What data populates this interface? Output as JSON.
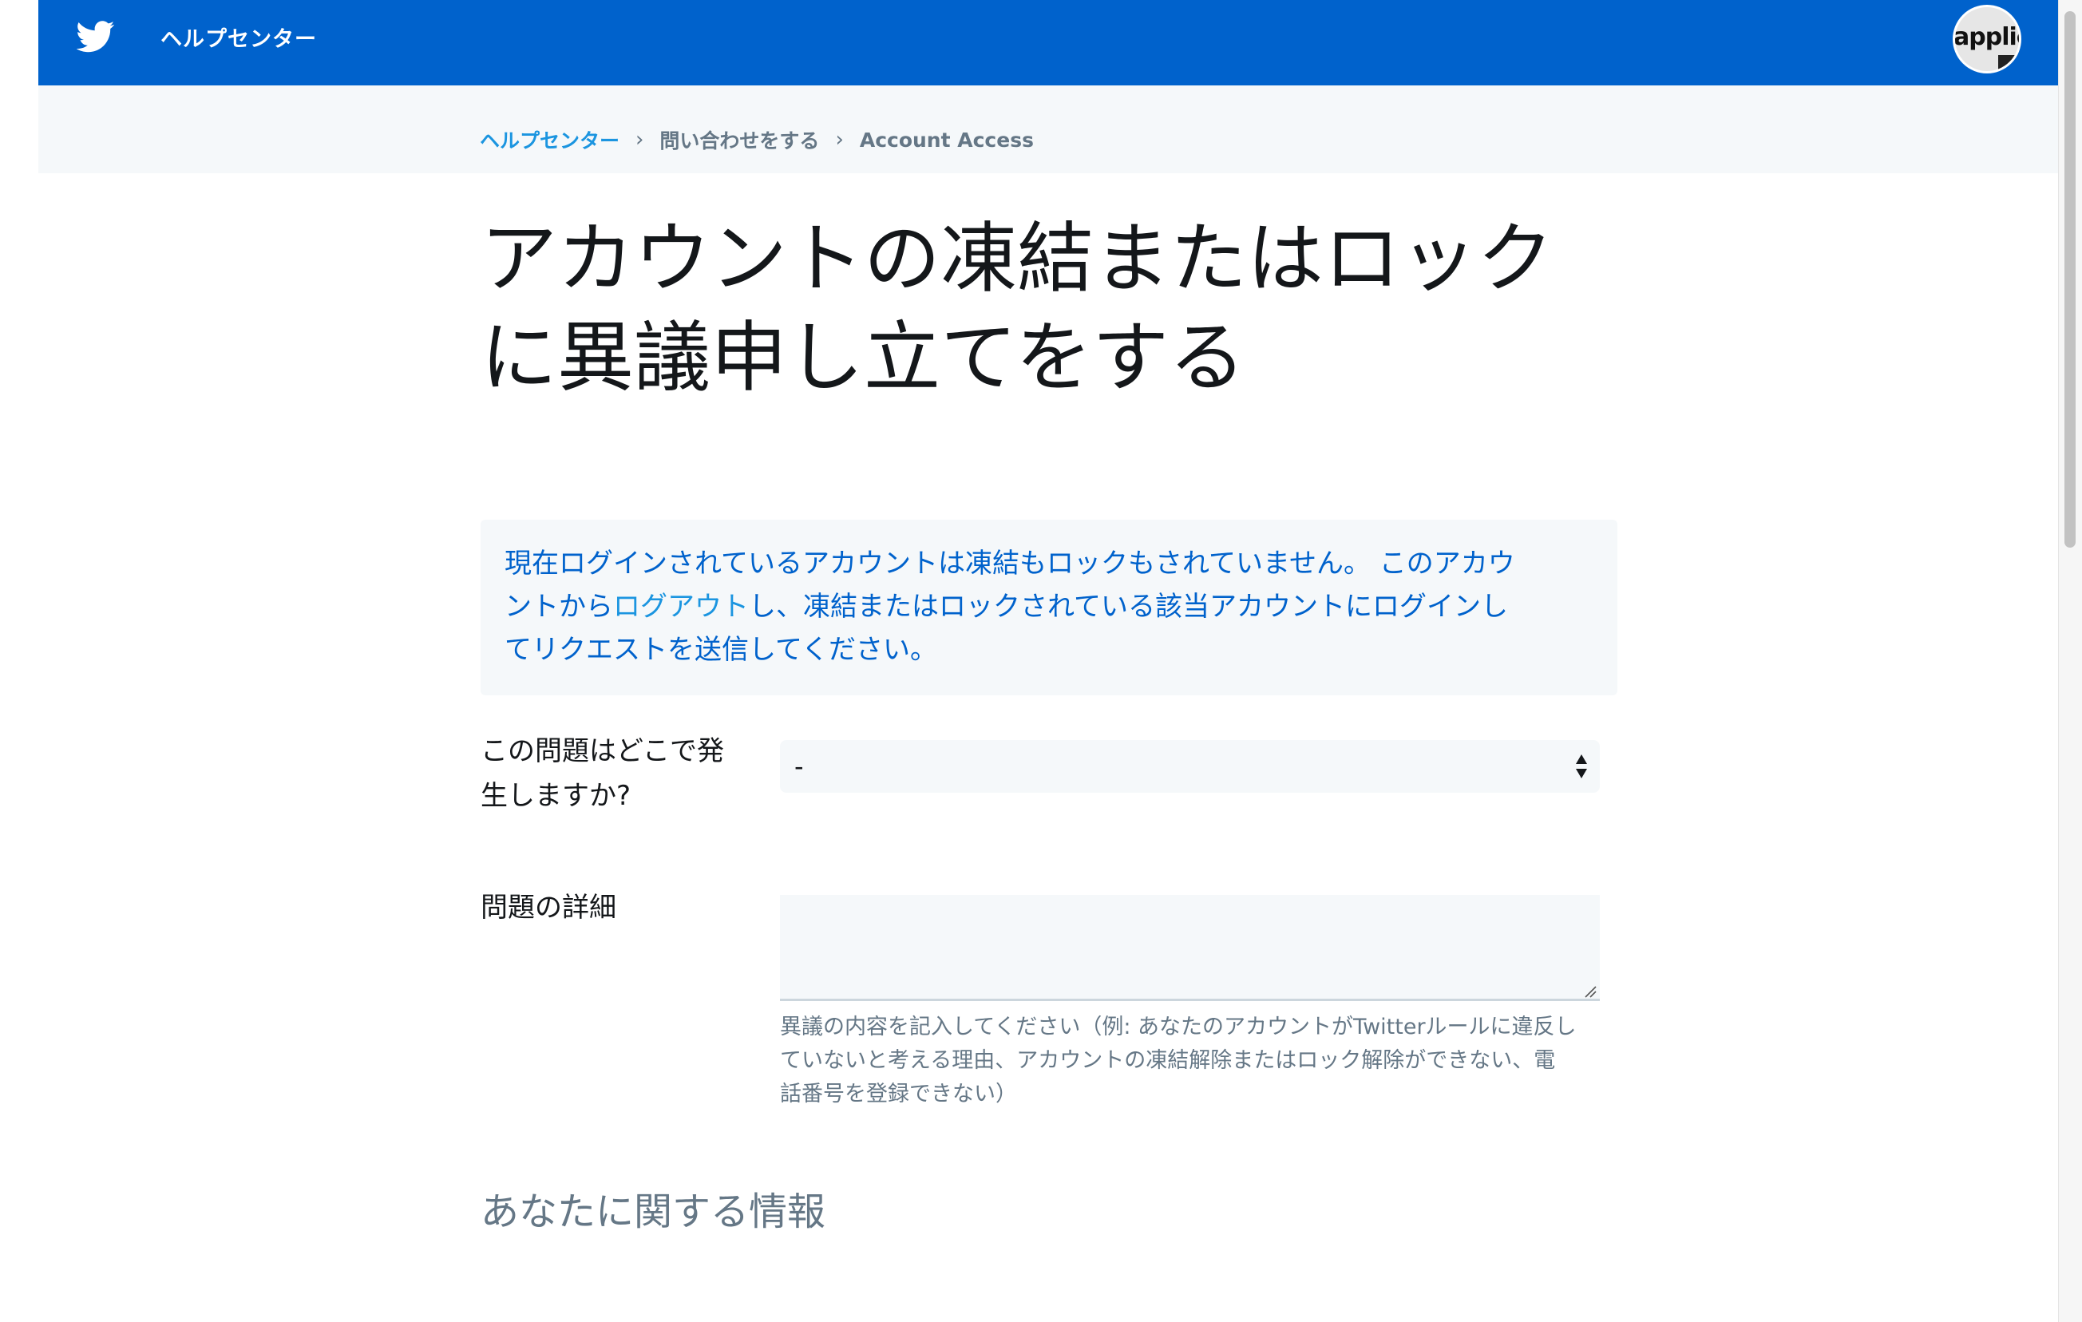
{
  "header": {
    "brand": "ヘルプセンター",
    "avatar_text": "applic",
    "logo_icon": "twitter-bird-icon"
  },
  "breadcrumb": [
    {
      "label": "ヘルプセンター",
      "link": true
    },
    {
      "label": "問い合わせをする",
      "link": false
    },
    {
      "label": "Account Access",
      "link": false
    }
  ],
  "page": {
    "title_line1": "アカウントの凍結またはロック",
    "title_line2": "に異議申し立てをする"
  },
  "notice": {
    "line1": "現在ログインされているアカウントは凍結もロックもされていません。 このアカウ",
    "line2_pre": "ントから",
    "line2_link": "ログアウト",
    "line2_post": "し、凍結またはロックされている該当アカウントにログインし",
    "line3": "てリクエストを送信してください。"
  },
  "form": {
    "where_label_line1": "この問題はどこで発",
    "where_label_line2": "生しますか?",
    "where_value": "-",
    "details_label": "問題の詳細",
    "details_value": "",
    "details_help_line1": "異議の内容を記入してください（例: あなたのアカウントがTwitterルールに違反し",
    "details_help_line2": "ていないと考える理由、アカウントの凍結解除またはロック解除ができない、電",
    "details_help_line3": "話番号を登録できない）"
  },
  "section": {
    "about_you": "あなたに関する情報"
  },
  "colors": {
    "header_bg": "#0062cc",
    "link": "#1b95e0",
    "notice_text": "#0062cc",
    "muted": "#657786",
    "panel_bg": "#f5f8fa"
  }
}
